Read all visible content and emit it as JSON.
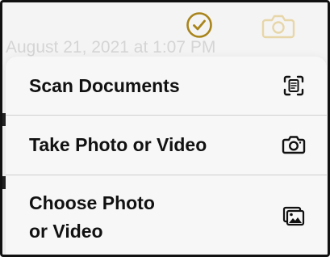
{
  "note": {
    "date_text": "August 21, 2021 at 1:07 PM"
  },
  "toolbar": {
    "done_icon": "checkmark-circle-icon",
    "camera_icon": "camera-icon",
    "accent_color": "#a8841a"
  },
  "menu": {
    "items": [
      {
        "label": "Scan Documents",
        "icon": "scan-document-icon"
      },
      {
        "label": "Take Photo or Video",
        "icon": "camera-icon"
      },
      {
        "label_line1": "Choose Photo",
        "label_line2": "or Video",
        "icon": "photo-library-icon"
      }
    ]
  }
}
